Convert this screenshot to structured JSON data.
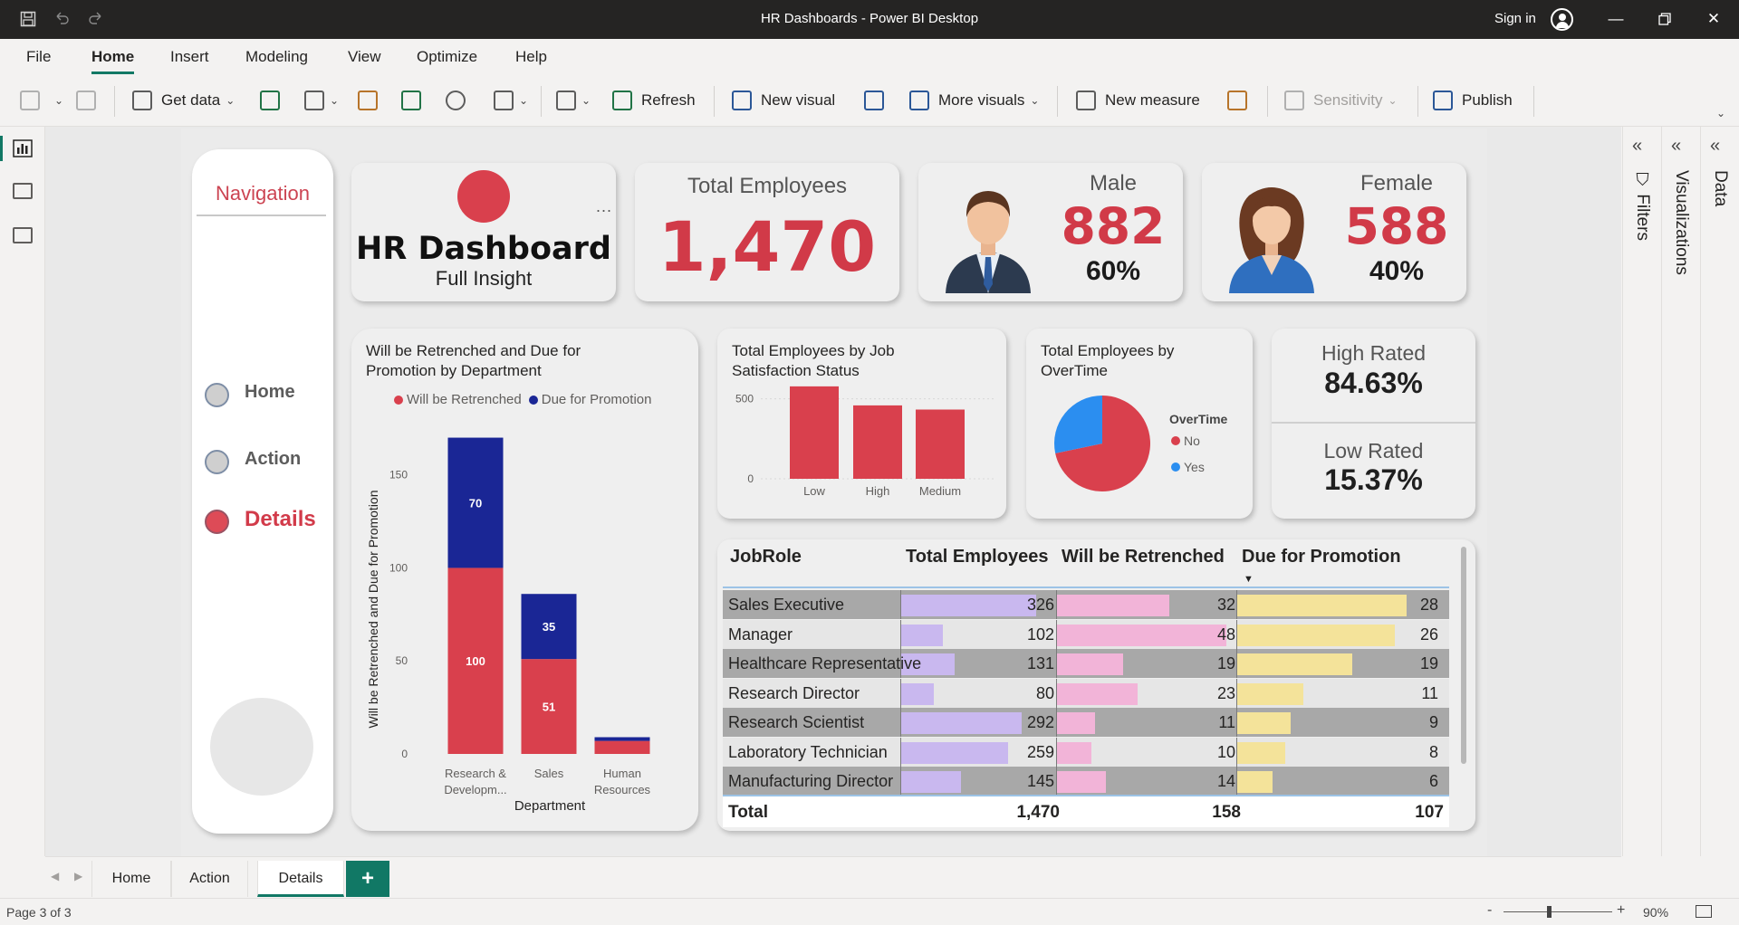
{
  "window": {
    "title": "HR Dashboards - Power BI Desktop",
    "signin": "Sign in"
  },
  "menu": [
    "File",
    "Home",
    "Insert",
    "Modeling",
    "View",
    "Optimize",
    "Help"
  ],
  "ribbon": {
    "get_data": "Get data",
    "refresh": "Refresh",
    "new_visual": "New visual",
    "more_visuals": "More visuals",
    "new_measure": "New measure",
    "sensitivity": "Sensitivity",
    "publish": "Publish"
  },
  "navigation": {
    "title": "Navigation",
    "items": [
      "Home",
      "Action",
      "Details"
    ],
    "active": "Details"
  },
  "header_card": {
    "title": "HR Dashboard",
    "subtitle": "Full Insight",
    "more": "..."
  },
  "total_employees": {
    "label": "Total Employees",
    "value": "1,470"
  },
  "male": {
    "label": "Male",
    "value": "882",
    "pct": "60%"
  },
  "female": {
    "label": "Female",
    "value": "588",
    "pct": "40%"
  },
  "stacked_chart": {
    "title_line1": "Will be Retrenched and Due for",
    "title_line2": "Promotion by Department",
    "ylabel": "Will be Retrenched and Due for Promotion",
    "xlabel": "Department",
    "legend": [
      "Will be Retrenched",
      "Due for Promotion"
    ]
  },
  "satisfaction_chart": {
    "title_line1": "Total Employees by Job",
    "title_line2": "Satisfaction Status"
  },
  "overtime_chart": {
    "title_line1": "Total Employees by",
    "title_line2": "OverTime",
    "legend_title": "OverTime",
    "legend": [
      "No",
      "Yes"
    ]
  },
  "rating": {
    "high_label": "High Rated",
    "high_value": "84.63%",
    "low_label": "Low Rated",
    "low_value": "15.37%"
  },
  "table": {
    "columns": [
      "JobRole",
      "Total Employees",
      "Will be Retrenched",
      "Due for Promotion"
    ],
    "rows": [
      {
        "role": "Sales Executive",
        "total": 326,
        "retrenched": 32,
        "promotion": 28
      },
      {
        "role": "Manager",
        "total": 102,
        "retrenched": 48,
        "promotion": 26
      },
      {
        "role": "Healthcare Representative",
        "total": 131,
        "retrenched": 19,
        "promotion": 19
      },
      {
        "role": "Research Director",
        "total": 80,
        "retrenched": 23,
        "promotion": 11
      },
      {
        "role": "Research Scientist",
        "total": 292,
        "retrenched": 11,
        "promotion": 9
      },
      {
        "role": "Laboratory Technician",
        "total": 259,
        "retrenched": 10,
        "promotion": 8
      },
      {
        "role": "Manufacturing Director",
        "total": 145,
        "retrenched": 14,
        "promotion": 6
      }
    ],
    "total_label": "Total",
    "totals": {
      "total": "1,470",
      "retrenched": "158",
      "promotion": "107"
    }
  },
  "panes": {
    "filters": "Filters",
    "visualizations": "Visualizations",
    "data": "Data"
  },
  "page_tabs": [
    "Home",
    "Action",
    "Details"
  ],
  "active_tab": "Details",
  "add_tab": "+",
  "status": {
    "page": "Page 3 of 3",
    "zoom": "90%",
    "minus": "-",
    "plus": "+"
  },
  "colors": {
    "red": "#d9404d",
    "navy": "#1a2695",
    "blue": "#2b8ef0",
    "accent": "#117865"
  },
  "chart_data": [
    {
      "type": "bar",
      "stacked": true,
      "categories": [
        "Research & Developm...",
        "Sales",
        "Human Resources"
      ],
      "category_lines": [
        [
          "Research &",
          "Developm..."
        ],
        [
          "Sales"
        ],
        [
          "Human",
          "Resources"
        ]
      ],
      "series": [
        {
          "name": "Will be Retrenched",
          "values": [
            100,
            51,
            7
          ]
        },
        {
          "name": "Due for Promotion",
          "values": [
            70,
            35,
            2
          ]
        }
      ],
      "data_labels": [
        [
          "100",
          "51",
          ""
        ],
        [
          "70",
          "35",
          ""
        ]
      ],
      "yticks": [
        0,
        50,
        100,
        150
      ],
      "ylim": [
        0,
        180
      ],
      "xlabel": "Department",
      "ylabel": "Will be Retrenched and Due for Promotion",
      "legend": "top"
    },
    {
      "type": "bar",
      "categories": [
        "Low",
        "High",
        "Medium"
      ],
      "values": [
        578,
        459,
        433
      ],
      "yticks": [
        0,
        500
      ],
      "ylim": [
        0,
        600
      ]
    },
    {
      "type": "pie",
      "labels": [
        "No",
        "Yes"
      ],
      "values": [
        1054,
        416
      ],
      "legend_title": "OverTime",
      "legend": "right"
    }
  ]
}
